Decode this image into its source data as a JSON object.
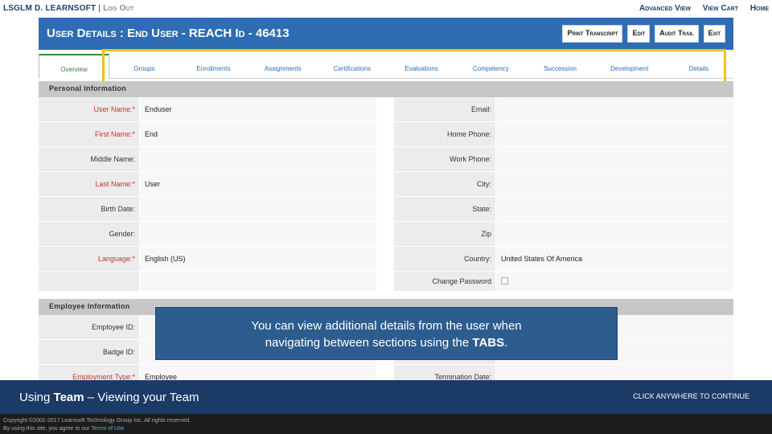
{
  "topbar": {
    "brand": "LSGLM D. LEARNSOFT",
    "separator": "|",
    "logout": "Log Out",
    "links": [
      "Advanced View",
      "View Cart",
      "Home"
    ]
  },
  "header": {
    "title": "User Details : End User - REACH Id - 46413",
    "buttons": [
      "Print Transcript",
      "Edit",
      "Audit Trail",
      "Exit"
    ]
  },
  "tabs": [
    {
      "label": "Overview",
      "active": true
    },
    {
      "label": "Groups"
    },
    {
      "label": "Enrollments"
    },
    {
      "label": "Assignments"
    },
    {
      "label": "Certifications"
    },
    {
      "label": "Evaluations"
    },
    {
      "label": "Competency"
    },
    {
      "label": "Succession"
    },
    {
      "label": "Development"
    },
    {
      "label": "Details"
    }
  ],
  "personal": {
    "heading": "Personal Information",
    "left": [
      {
        "label": "User Name:*",
        "value": "Enduser",
        "required": true
      },
      {
        "label": "First Name:*",
        "value": "End",
        "required": true
      },
      {
        "label": "Middle Name:",
        "value": ""
      },
      {
        "label": "Last Name:*",
        "value": "User",
        "required": true
      },
      {
        "label": "Birth Date:",
        "value": ""
      },
      {
        "label": "Gender:",
        "value": ""
      },
      {
        "label": "Language:*",
        "value": "English (US)",
        "required": true
      }
    ],
    "right": [
      {
        "label": "Email:",
        "value": ""
      },
      {
        "label": "Home Phone:",
        "value": ""
      },
      {
        "label": "Work Phone:",
        "value": ""
      },
      {
        "label": "City:",
        "value": ""
      },
      {
        "label": "State:",
        "value": ""
      },
      {
        "label": "Zip",
        "value": ""
      },
      {
        "label": "Country:",
        "value": "United States Of America"
      }
    ],
    "change_password_label": "Change Password"
  },
  "employee": {
    "heading": "Employee Information",
    "left": [
      {
        "label": "Employee ID:",
        "value": ""
      },
      {
        "label": "Badge ID:",
        "value": ""
      },
      {
        "label": "Employment Type:*",
        "value": "Employee",
        "required": true
      }
    ],
    "right": [
      {
        "label": "",
        "value": ""
      },
      {
        "label": "",
        "value": ""
      },
      {
        "label": "Termination Date:",
        "value": ""
      }
    ]
  },
  "callout": {
    "line1": "You can view additional details from the user when",
    "line2_pre": "navigating between sections using the ",
    "line2_bold": "TABS",
    "line2_post": "."
  },
  "bottombar": {
    "title_pre": "Using ",
    "title_bold": "Team",
    "title_post": " – Viewing your Team",
    "continue": "CLICK ANYWHERE TO CONTINUE"
  },
  "footer": {
    "copyright": "Copyright ©2001-2017 Learnsoft Technology Group Inc. All rights reserved.",
    "agree_pre": "By using this site, you agree to our ",
    "terms_link": "Terms of Use"
  },
  "colors": {
    "header_blue": "#2e6db3",
    "callout_blue": "#2d5c8e",
    "bottombar_navy": "#1b3a66",
    "highlight_yellow": "#f2c315",
    "required_red": "#c0392b"
  }
}
